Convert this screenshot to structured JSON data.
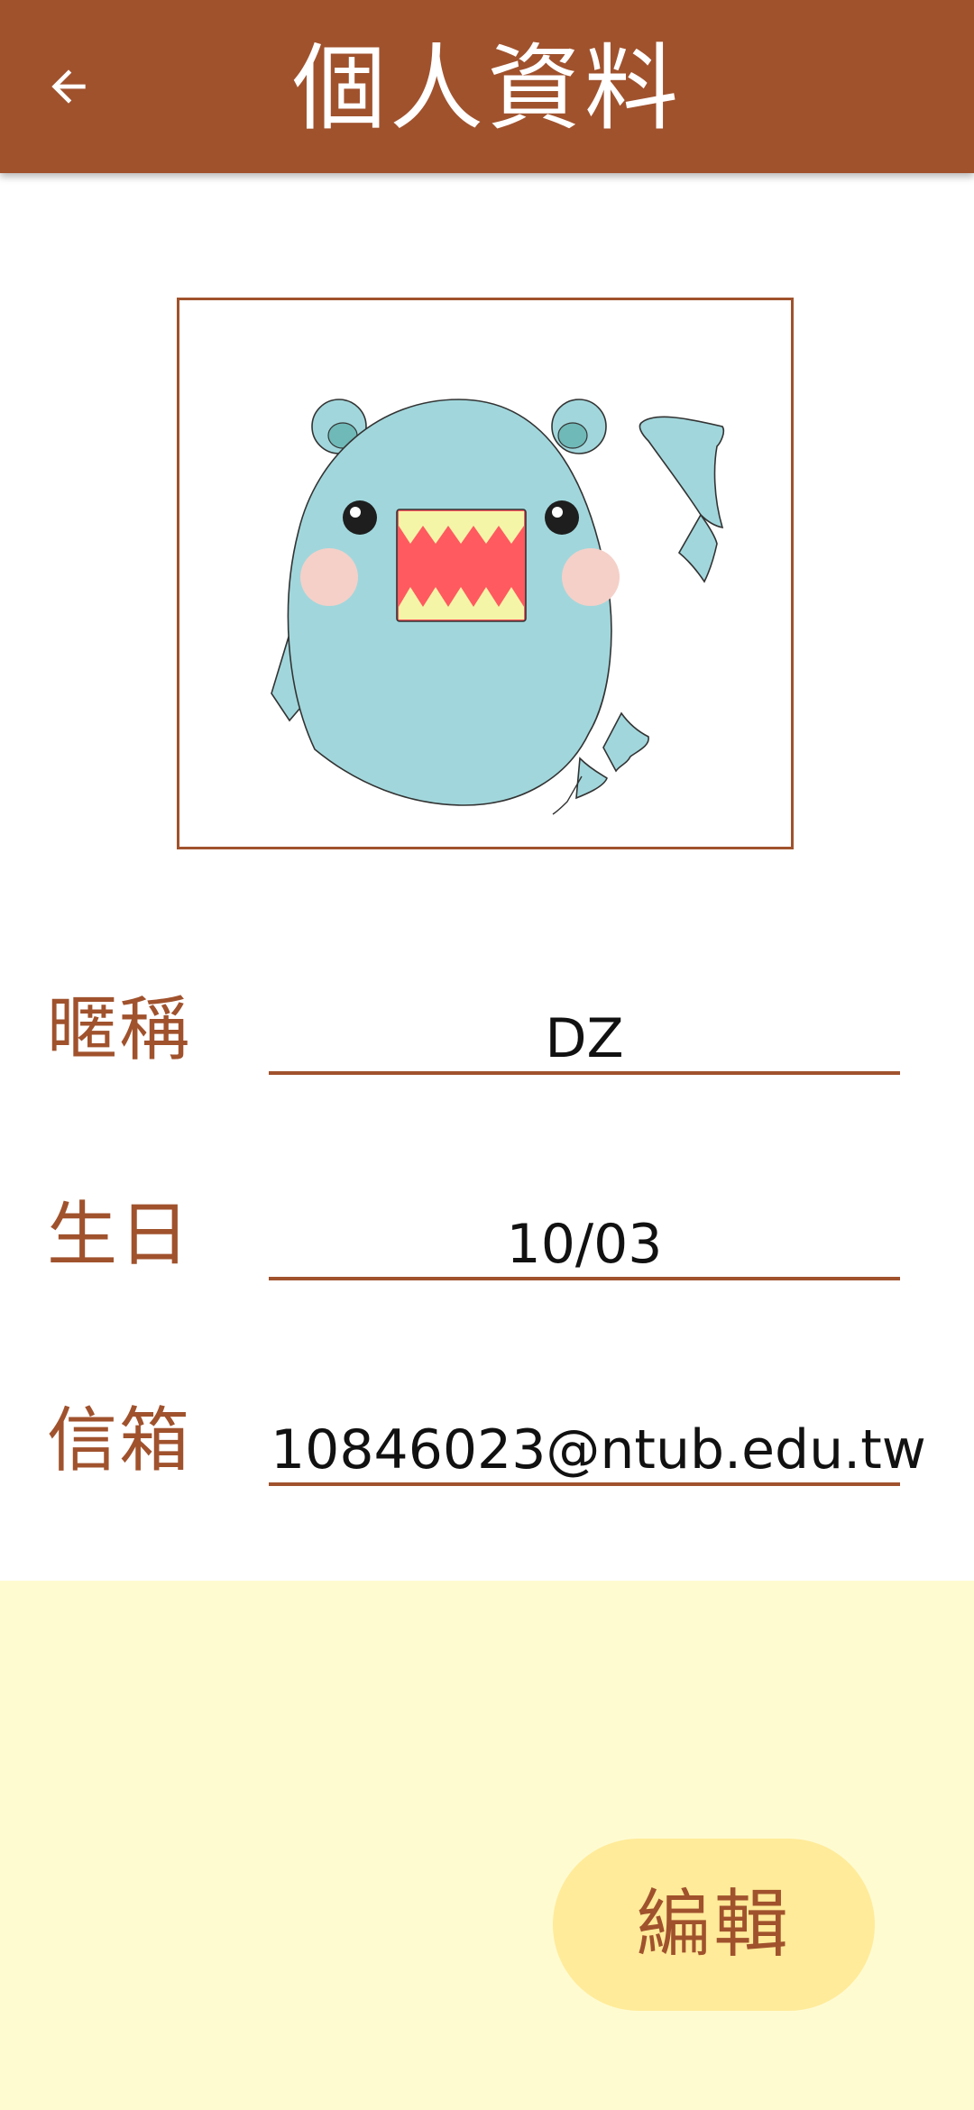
{
  "app_bar": {
    "title": "個人資料",
    "back_icon": "arrow-back-icon",
    "color": "#a0522d"
  },
  "avatar": {
    "icon": "monster-avatar",
    "frame_color": "#a0522d"
  },
  "profile": {
    "nickname": {
      "label": "暱稱",
      "value": "DZ"
    },
    "birthday": {
      "label": "生日",
      "value": "10/03"
    },
    "email": {
      "label": "信箱",
      "value": "10846023@ntub.edu.tw"
    }
  },
  "actions": {
    "edit_label": "編輯"
  },
  "colors": {
    "accent": "#a0522d",
    "panel_background": "#fffbd1",
    "button_background": "#ffeb99"
  }
}
